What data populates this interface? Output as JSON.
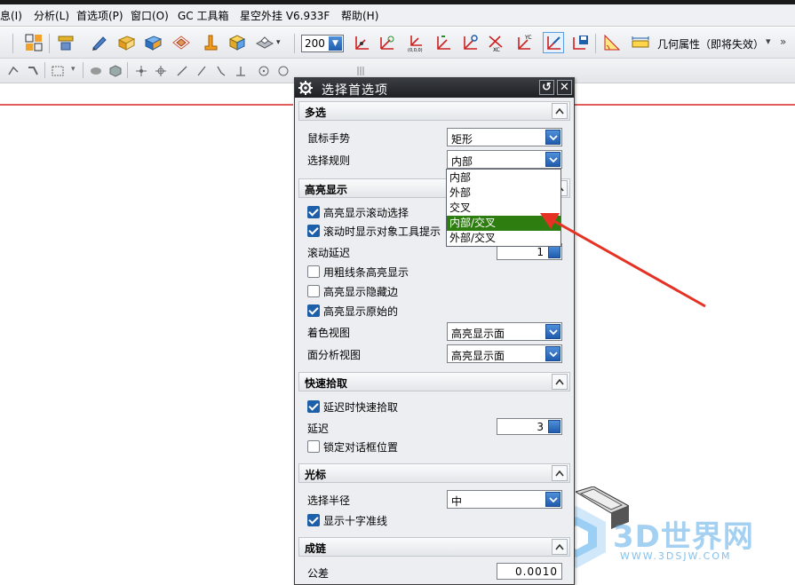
{
  "menu": [
    "息(I)",
    "分析(L)",
    "首选项(P)",
    "窗口(O)",
    "GC 工具箱",
    "星空外挂 V6.933F",
    "帮助(H)"
  ],
  "toolbar": {
    "zoom_value": "200",
    "geometry_property_label": "几何属性（即将失效）",
    "more": "»"
  },
  "dialog": {
    "title": "选择首选项",
    "sections": {
      "multi": "多选",
      "highlight": "高亮显示",
      "quickpick": "快速拾取",
      "cursor": "光标",
      "chain": "成链"
    },
    "mouse_gesture_label": "鼠标手势",
    "mouse_gesture_value": "矩形",
    "select_rule_label": "选择规则",
    "select_rule_value": "内部",
    "select_rule_options": [
      "内部",
      "外部",
      "交叉",
      "内部/交叉",
      "外部/交叉"
    ],
    "select_rule_selected_index": 3,
    "highlight_scroll_select": {
      "label": "高亮显示滚动选择",
      "checked": true
    },
    "show_tooltip_scroll": {
      "label": "滚动时显示对象工具提示",
      "checked": true
    },
    "scroll_delay_label": "滚动延迟",
    "scroll_delay_value": "1",
    "thick_line_highlight": {
      "label": "用粗线条高亮显示",
      "checked": false
    },
    "highlight_hidden_edges": {
      "label": "高亮显示隐藏边",
      "checked": false
    },
    "highlight_original": {
      "label": "高亮显示原始的",
      "checked": true
    },
    "shaded_view_label": "着色视图",
    "shaded_view_value": "高亮显示面",
    "face_analysis_label": "面分析视图",
    "face_analysis_value": "高亮显示面",
    "delay_quickpick": {
      "label": "延迟时快速拾取",
      "checked": true
    },
    "delay_label": "延迟",
    "delay_value": "3",
    "lock_dialog_pos": {
      "label": "锁定对话框位置",
      "checked": false
    },
    "select_radius_label": "选择半径",
    "select_radius_value": "中",
    "show_crosshair": {
      "label": "显示十字准线",
      "checked": true
    },
    "tolerance_label": "公差",
    "tolerance_value": "0.0010"
  },
  "watermark": {
    "text": "3D世界网",
    "url": "WWW.3DSJW.COM"
  },
  "colors": {
    "selection": "#2e7d10",
    "arrow": "#e53224",
    "titlebar": "#2a2d31"
  }
}
